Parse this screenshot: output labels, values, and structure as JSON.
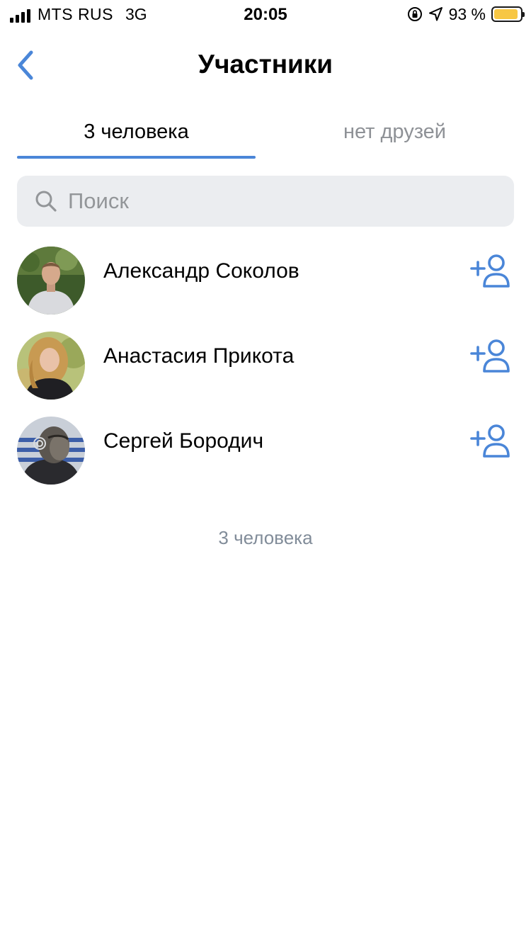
{
  "status_bar": {
    "carrier": "MTS RUS",
    "network": "3G",
    "time": "20:05",
    "battery_percent": "93 %",
    "battery_level": 0.93,
    "battery_color": "#f7c744",
    "signal_bars": 4,
    "icons": [
      "orientation-lock-icon",
      "location-arrow-icon"
    ]
  },
  "nav": {
    "title": "Участники",
    "back_icon": "chevron-left-icon"
  },
  "tabs": [
    {
      "label": "3 человека",
      "active": true
    },
    {
      "label": "нет друзей",
      "active": false
    }
  ],
  "search": {
    "placeholder": "Поиск",
    "value": ""
  },
  "members": [
    {
      "name": "Александр Соколов",
      "action_icon": "add-friend-icon"
    },
    {
      "name": "Анастасия Прикота",
      "action_icon": "add-friend-icon"
    },
    {
      "name": "Сергей Бородич",
      "action_icon": "add-friend-icon"
    }
  ],
  "footer": {
    "count_text": "3 человека"
  },
  "colors": {
    "accent": "#4a86d8",
    "inactive_text": "#8e9196",
    "search_bg": "#ebedf0",
    "footer_text": "#818c99"
  }
}
